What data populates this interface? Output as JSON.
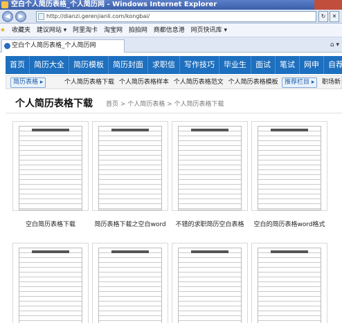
{
  "window": {
    "title": "空白个人简历表格_个人简历网 - Windows Internet Explorer"
  },
  "address": {
    "url": "http://dianzi.gerenjianli.com/kongbai/"
  },
  "favorites": {
    "label": "收藏夹",
    "items": [
      "建议网站 ▾",
      "阿里淘卡",
      "淘宝网",
      "拍拍网",
      "商都信息港",
      "网页快讯库 ▾"
    ]
  },
  "tab": {
    "title": "空白个人简历表格_个人简历网"
  },
  "mainnav": [
    "首页",
    "简历大全",
    "简历模板",
    "简历封面",
    "求职信",
    "写作技巧",
    "毕业生",
    "面试",
    "笔试",
    "网申",
    "自荐书"
  ],
  "subnav": {
    "left_button": "简历表格 ▸",
    "links": [
      "个人简历表格下载",
      "个人简历表格样本",
      "个人简历表格范文",
      "个人简历表格模板"
    ],
    "right_button": "推荐栏目 ▸",
    "right_text": "职场新"
  },
  "page": {
    "title": "个人简历表格下载",
    "breadcrumb": "首页 > 个人简历表格 > 个人简历表格下载"
  },
  "thumbs": [
    {
      "caption": "空白简历表格下载"
    },
    {
      "caption": "简历表格下载之空白word"
    },
    {
      "caption": "不错的求职简历空白表格"
    },
    {
      "caption": "空白的简历表格word格式"
    }
  ]
}
